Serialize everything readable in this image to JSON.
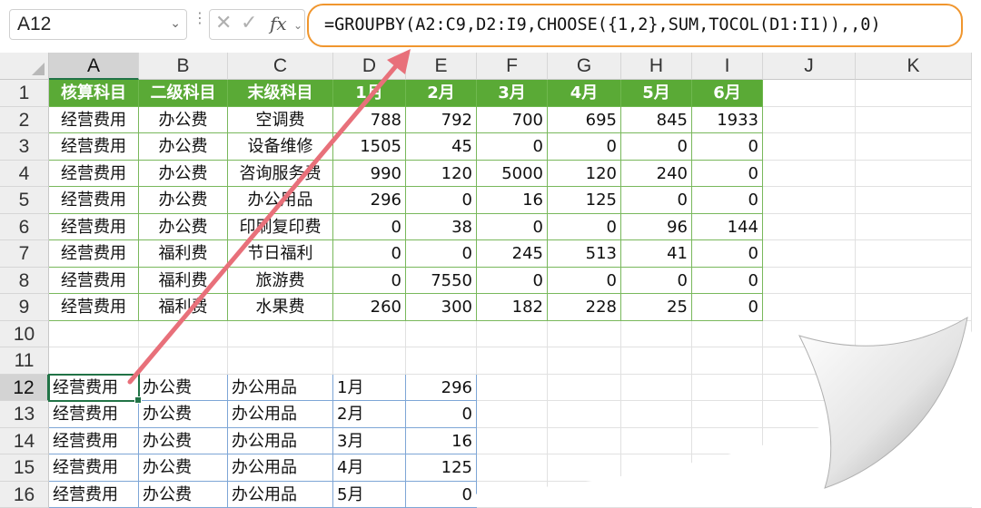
{
  "formula_bar": {
    "name_box": "A12",
    "formula": "=GROUPBY(A2:C9,D2:I9,CHOOSE({1,2},SUM,TOCOL(D1:I1)),,0)",
    "fx_label": "fx"
  },
  "columns": [
    "A",
    "B",
    "C",
    "D",
    "E",
    "F",
    "G",
    "H",
    "I",
    "J",
    "K"
  ],
  "rows": [
    "1",
    "2",
    "3",
    "4",
    "5",
    "6",
    "7",
    "8",
    "9",
    "10",
    "11",
    "12",
    "13",
    "14",
    "15",
    "16"
  ],
  "source_table": {
    "headers": [
      "核算科目",
      "二级科目",
      "末级科目",
      "1月",
      "2月",
      "3月",
      "4月",
      "5月",
      "6月"
    ],
    "rows": [
      [
        "经营费用",
        "办公费",
        "空调费",
        "788",
        "792",
        "700",
        "695",
        "845",
        "1933"
      ],
      [
        "经营费用",
        "办公费",
        "设备维修",
        "1505",
        "45",
        "0",
        "0",
        "0",
        "0"
      ],
      [
        "经营费用",
        "办公费",
        "咨询服务费",
        "990",
        "120",
        "5000",
        "120",
        "240",
        "0"
      ],
      [
        "经营费用",
        "办公费",
        "办公用品",
        "296",
        "0",
        "16",
        "125",
        "0",
        "0"
      ],
      [
        "经营费用",
        "办公费",
        "印刷复印费",
        "0",
        "38",
        "0",
        "0",
        "96",
        "144"
      ],
      [
        "经营费用",
        "福利费",
        "节日福利",
        "0",
        "0",
        "245",
        "513",
        "41",
        "0"
      ],
      [
        "经营费用",
        "福利费",
        "旅游费",
        "0",
        "7550",
        "0",
        "0",
        "0",
        "0"
      ],
      [
        "经营费用",
        "福利费",
        "水果费",
        "260",
        "300",
        "182",
        "228",
        "25",
        "0"
      ]
    ]
  },
  "result_rows": [
    [
      "经营费用",
      "办公费",
      "办公用品",
      "1月",
      "296"
    ],
    [
      "经营费用",
      "办公费",
      "办公用品",
      "2月",
      "0"
    ],
    [
      "经营费用",
      "办公费",
      "办公用品",
      "3月",
      "16"
    ],
    [
      "经营费用",
      "办公费",
      "办公用品",
      "4月",
      "125"
    ],
    [
      "经营费用",
      "办公费",
      "办公用品",
      "5月",
      "0"
    ]
  ],
  "colors": {
    "header_green": "#5aaa36",
    "formula_outline": "#f0962e",
    "arrow": "#e8707a",
    "selection_green": "#217346"
  }
}
